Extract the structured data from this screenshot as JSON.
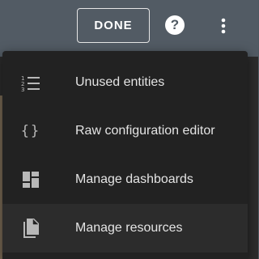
{
  "toolbar": {
    "done_label": "DONE",
    "help_icon": "help-circle-icon",
    "more_icon": "more-vertical-icon"
  },
  "menu": {
    "items": [
      {
        "label": "Unused entities",
        "icon": "unused-entities-icon"
      },
      {
        "label": "Raw configuration editor",
        "icon": "code-braces-icon",
        "glyph": "{}"
      },
      {
        "label": "Manage dashboards",
        "icon": "dashboard-icon"
      },
      {
        "label": "Manage resources",
        "icon": "file-icon"
      }
    ],
    "highlighted_item": "Manage resources"
  },
  "colors": {
    "header_bg": "#4f5962",
    "menu_bg": "#222222",
    "menu_text": "#e4e4e4",
    "icon": "#b8b8b8"
  }
}
